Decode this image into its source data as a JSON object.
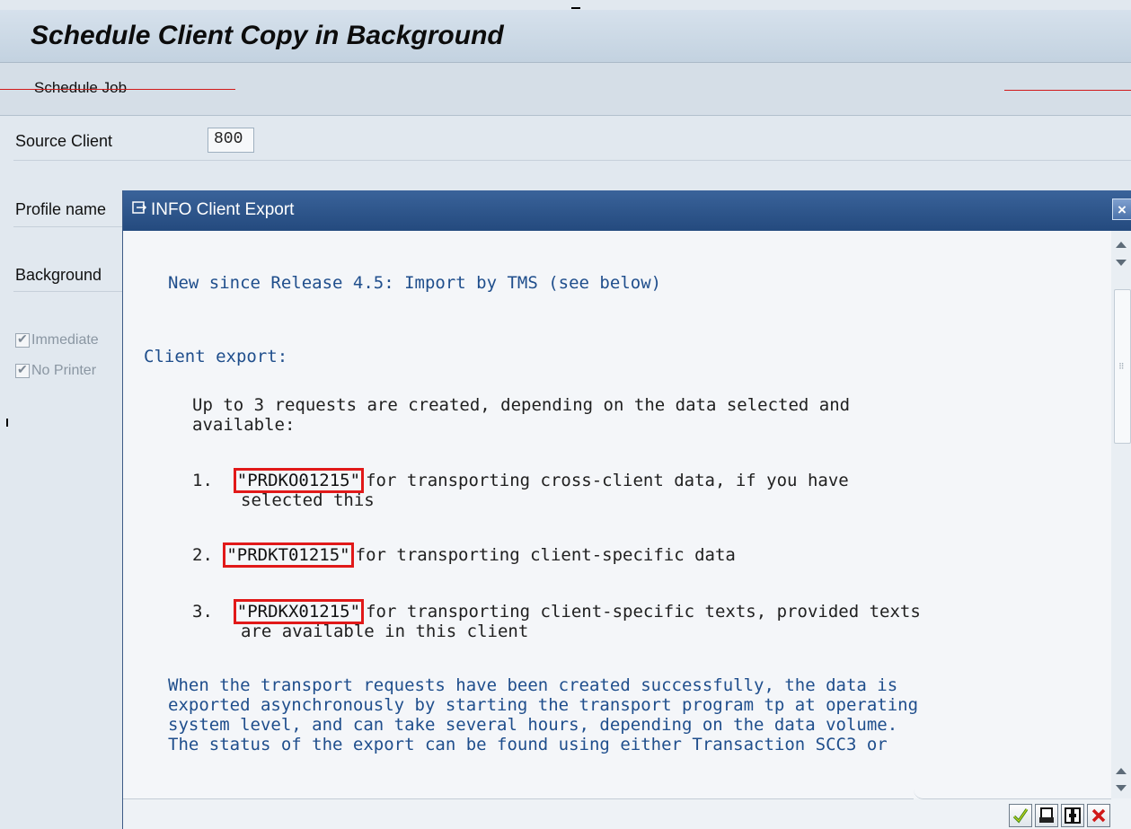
{
  "window": {
    "title": "Schedule Client Copy in Background"
  },
  "toolbar": {
    "schedule_job": "Schedule Job"
  },
  "form": {
    "source_client_label": "Source Client",
    "source_client_value": "800",
    "profile_name_label": "Profile name",
    "background_label": "Background",
    "immediately_label": "Immediate",
    "no_printer_label": "No Printer"
  },
  "dialog": {
    "title": "INFO Client Export",
    "close": "×",
    "heading": "New since Release 4.5: Import by TMS (see below)",
    "section": "Client export:",
    "intro_line1": "Up to 3 requests are created, depending on the data selected and",
    "intro_line2": "available:",
    "items": [
      {
        "num": "1.",
        "code": "\"PRDKO01215\"",
        "text1": "for transporting cross-client data, if you have",
        "text2": "selected this"
      },
      {
        "num": "2.",
        "code": "\"PRDKT01215\"",
        "text1": "for transporting client-specific data"
      },
      {
        "num": "3.",
        "code": "\"PRDKX01215\"",
        "text1": "for transporting client-specific texts, provided texts",
        "text2": "are available in this client"
      }
    ],
    "para": [
      "When the transport requests have been created successfully, the data is",
      "exported asynchronously by starting the transport program tp at operating",
      "system level, and can take several hours, depending on the data volume.",
      "The status of the export can be found using either Transaction SCC3 or"
    ]
  },
  "footer_buttons": [
    "continue-icon",
    "print-icon",
    "save-icon",
    "cancel-icon"
  ],
  "colors": {
    "title_bar": "#244a7e",
    "info_text": "#1f4e8c",
    "highlight_border": "#e11919"
  }
}
